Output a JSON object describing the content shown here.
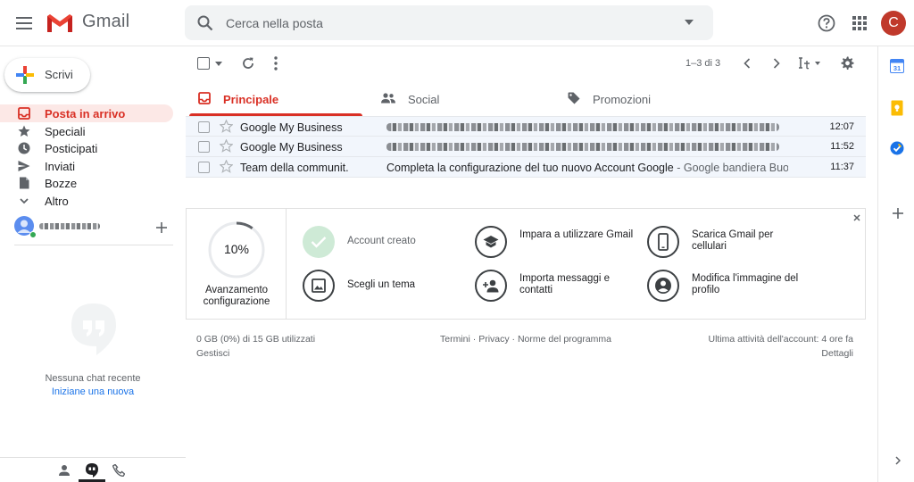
{
  "app": {
    "name": "Gmail",
    "avatar_letter": "C"
  },
  "search": {
    "placeholder": "Cerca nella posta"
  },
  "compose": {
    "label": "Scrivi"
  },
  "nav": {
    "items": [
      {
        "label": "Posta in arrivo",
        "icon": "inbox-icon",
        "active": true
      },
      {
        "label": "Speciali",
        "icon": "star-icon"
      },
      {
        "label": "Posticipati",
        "icon": "clock-icon"
      },
      {
        "label": "Inviati",
        "icon": "send-icon"
      },
      {
        "label": "Bozze",
        "icon": "draft-icon"
      },
      {
        "label": "Altro",
        "icon": "chevron-down-icon"
      }
    ]
  },
  "hangouts": {
    "empty_text": "Nessuna chat recente",
    "start_new": "Iniziane una nuova"
  },
  "toolbar": {
    "pager": "1–3 di 3"
  },
  "tabs": [
    {
      "label": "Principale",
      "icon": "inbox-icon",
      "active": true
    },
    {
      "label": "Social",
      "icon": "people-icon"
    },
    {
      "label": "Promozioni",
      "icon": "tag-icon"
    }
  ],
  "emails": [
    {
      "sender": "Google My Business",
      "subject": "",
      "snippet": "",
      "time": "12:07",
      "redacted": true
    },
    {
      "sender": "Google My Business",
      "subject": "",
      "snippet": "",
      "time": "11:52",
      "redacted": true
    },
    {
      "sender": "Team della communit.",
      "subject": "Completa la configurazione del tuo nuovo Account Google",
      "snippet": " - Google bandiera Buon…",
      "time": "11:37",
      "redacted": false
    }
  ],
  "setup": {
    "progress_value": 10,
    "progress_text": "10%",
    "progress_label": "Avanzamento configurazione",
    "steps": [
      {
        "label": "Account creato",
        "icon": "check-icon",
        "done": true
      },
      {
        "label": "Impara a utilizzare Gmail",
        "icon": "school-icon"
      },
      {
        "label": "Scarica Gmail per cellulari",
        "icon": "phone-icon"
      },
      {
        "label": "Scegli un tema",
        "icon": "image-icon"
      },
      {
        "label": "Importa messaggi e contatti",
        "icon": "person-add-icon"
      },
      {
        "label": "Modifica l'immagine del profilo",
        "icon": "account-circle-icon"
      }
    ]
  },
  "footer": {
    "storage": "0 GB (0%) di 15 GB utilizzati",
    "manage": "Gestisci",
    "terms": "Termini",
    "privacy": "Privacy",
    "program": "Norme del programma",
    "sep": " · ",
    "last_activity": "Ultima attività dell'account: 4 ore fa",
    "details": "Dettagli"
  },
  "colors": {
    "red": "#d93025",
    "active_bg": "#fce8e6",
    "row_bg": "#f2f6fc",
    "done_green": "#ceead6"
  }
}
